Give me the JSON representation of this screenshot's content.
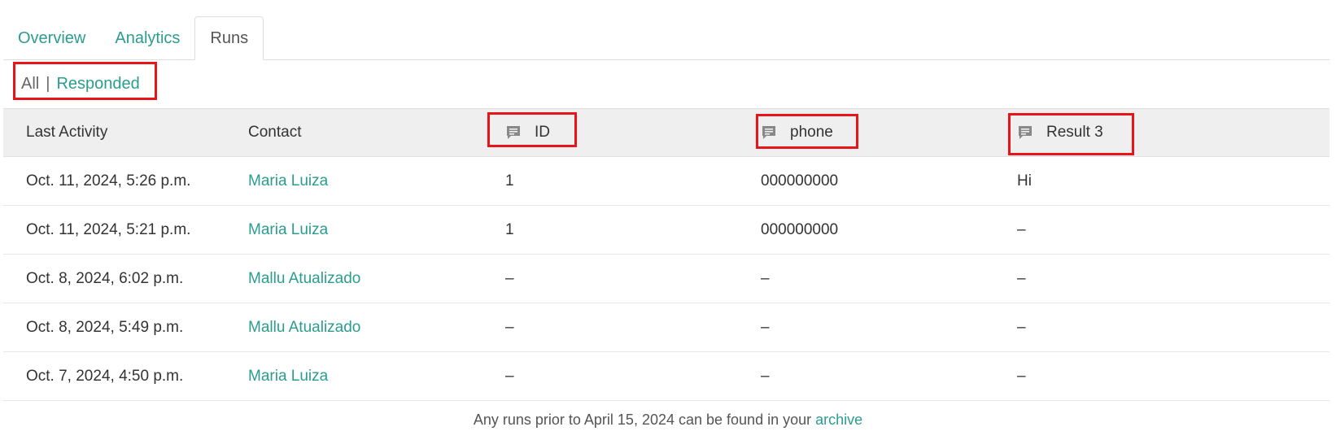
{
  "tabs": [
    {
      "label": "Overview",
      "active": false
    },
    {
      "label": "Analytics",
      "active": false
    },
    {
      "label": "Runs",
      "active": true
    }
  ],
  "filter": {
    "all_label": "All",
    "separator": "|",
    "responded_label": "Responded"
  },
  "table": {
    "headers": {
      "last_activity": "Last Activity",
      "contact": "Contact",
      "id": "ID",
      "phone": "phone",
      "result3": "Result 3"
    },
    "header_icon": "comment-icon",
    "rows": [
      {
        "last_activity": "Oct. 11, 2024, 5:26 p.m.",
        "contact": "Maria Luiza",
        "id": "1",
        "phone": "000000000",
        "result3": "Hi"
      },
      {
        "last_activity": "Oct. 11, 2024, 5:21 p.m.",
        "contact": "Maria Luiza",
        "id": "1",
        "phone": "000000000",
        "result3": "–"
      },
      {
        "last_activity": "Oct. 8, 2024, 6:02 p.m.",
        "contact": "Mallu Atualizado",
        "id": "–",
        "phone": "–",
        "result3": "–"
      },
      {
        "last_activity": "Oct. 8, 2024, 5:49 p.m.",
        "contact": "Mallu Atualizado",
        "id": "–",
        "phone": "–",
        "result3": "–"
      },
      {
        "last_activity": "Oct. 7, 2024, 4:50 p.m.",
        "contact": "Maria Luiza",
        "id": "–",
        "phone": "–",
        "result3": "–"
      }
    ]
  },
  "footer": {
    "text": "Any runs prior to April 15, 2024 can be found in your ",
    "link": "archive"
  },
  "colors": {
    "accent": "#2a9d8f",
    "highlight": "#e8141a",
    "header_bg": "#efefef"
  }
}
